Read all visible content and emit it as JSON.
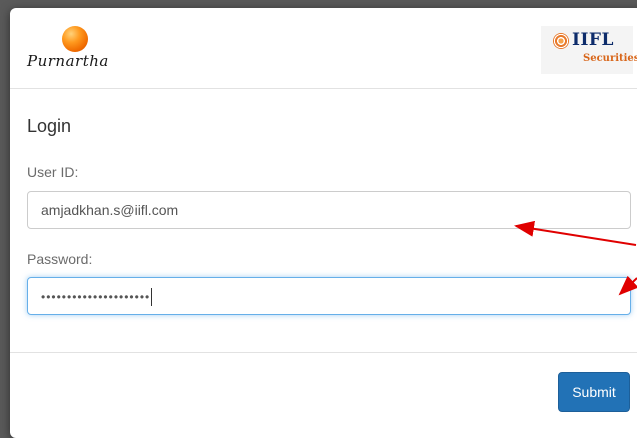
{
  "header": {
    "brand_name": "Purnartha",
    "partner_name": "IIFL",
    "partner_subtitle": "Securities"
  },
  "form": {
    "title": "Login",
    "user_id_label": "User ID:",
    "user_id_value": "amjadkhan.s@iifl.com",
    "password_label": "Password:",
    "password_masked": "•••••••••••••••••••••"
  },
  "footer": {
    "submit_label": "Submit"
  },
  "colors": {
    "primary_button": "#2272b6",
    "focus_border": "#66afe9",
    "annotation_arrow": "#e00000",
    "brand_orange": "#f07a10",
    "partner_navy": "#0d2c6b"
  },
  "icons": {
    "brand": "orange-ball-logo",
    "partner": "iifl-emblem-icon"
  }
}
